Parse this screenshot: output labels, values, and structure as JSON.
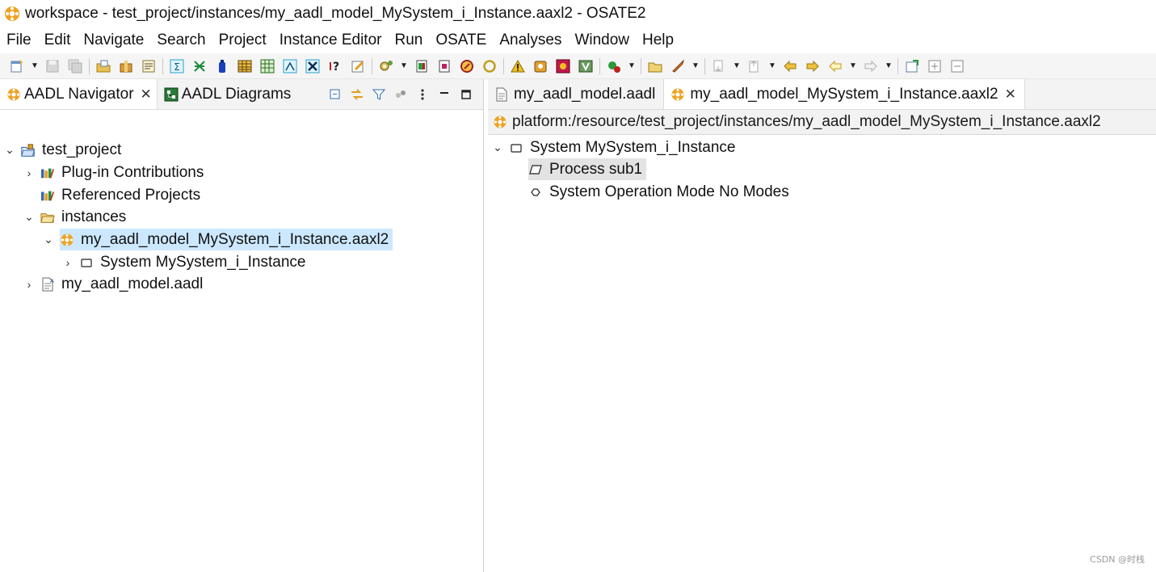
{
  "window": {
    "title": "workspace - test_project/instances/my_aadl_model_MySystem_i_Instance.aaxl2 - OSATE2",
    "app_icon": "osate-logo-icon"
  },
  "menu": [
    "File",
    "Edit",
    "Navigate",
    "Search",
    "Project",
    "Instance Editor",
    "Run",
    "OSATE",
    "Analyses",
    "Window",
    "Help"
  ],
  "toolbar": {
    "icons": [
      "new-icon",
      "save-icon",
      "save-all-icon",
      "open-aadl-icon",
      "package-icon",
      "properties-icon",
      "sigma-icon",
      "graph-icon",
      "bottle-icon",
      "table-icon",
      "grid-icon",
      "image-icon",
      "hourglass-icon",
      "help-question-icon",
      "edit-icon",
      "cog-icon",
      "run-icon",
      "doc-icon",
      "flag-icon",
      "ring-icon",
      "warning-icon",
      "archive-icon",
      "puzzle-icon",
      "shield-icon",
      "bug-icon",
      "folder-icon",
      "rocket-icon",
      "next-annotation-icon",
      "prev-annotation-icon",
      "back-edit-icon",
      "forward-edit-icon",
      "back-icon",
      "forward-icon",
      "pin-icon",
      "maximize-icon",
      "restore-icon"
    ]
  },
  "navigator": {
    "tabs": [
      {
        "label": "AADL Navigator",
        "icon": "aadl-navigator-icon",
        "active": true
      },
      {
        "label": "AADL Diagrams",
        "icon": "aadl-diagrams-icon",
        "active": false
      }
    ],
    "actions": [
      "collapse-all-icon",
      "link-editor-icon",
      "filter-icon",
      "dots-icon",
      "view-menu-icon",
      "minimize-icon",
      "maximize-icon"
    ],
    "tree": [
      {
        "label": "test_project",
        "icon": "project-folder-icon",
        "twisty": "expanded",
        "depth": 0
      },
      {
        "label": "Plug-in Contributions",
        "icon": "library-icon",
        "twisty": "collapsed",
        "depth": 1
      },
      {
        "label": "Referenced Projects",
        "icon": "library-icon",
        "twisty": "none",
        "depth": 1
      },
      {
        "label": "instances",
        "icon": "folder-icon",
        "twisty": "expanded",
        "depth": 1
      },
      {
        "label": "my_aadl_model_MySystem_i_Instance.aaxl2",
        "icon": "instance-file-icon",
        "twisty": "expanded",
        "depth": 2,
        "selected": true
      },
      {
        "label": "System MySystem_i_Instance",
        "icon": "system-icon",
        "twisty": "collapsed",
        "depth": 3
      },
      {
        "label": "my_aadl_model.aadl",
        "icon": "aadl-file-icon",
        "twisty": "collapsed",
        "depth": 1
      }
    ]
  },
  "editor": {
    "tabs": [
      {
        "label": "my_aadl_model.aadl",
        "icon": "aadl-file-icon",
        "active": false
      },
      {
        "label": "my_aadl_model_MySystem_i_Instance.aaxl2",
        "icon": "instance-file-icon",
        "active": true
      }
    ],
    "resource_uri": "platform:/resource/test_project/instances/my_aadl_model_MySystem_i_Instance.aaxl2",
    "tree": [
      {
        "label": "System MySystem_i_Instance",
        "icon": "system-icon",
        "twisty": "expanded",
        "depth": 0
      },
      {
        "label": "Process sub1",
        "icon": "process-icon",
        "twisty": "none",
        "depth": 1,
        "highlight": true
      },
      {
        "label": "System Operation Mode No Modes",
        "icon": "mode-icon",
        "twisty": "none",
        "depth": 1
      }
    ]
  },
  "watermark": "CSDN @时栈",
  "colors": {
    "selection": "#cce8ff",
    "highlight": "#e3e3e3",
    "osate_orange": "#f0a020",
    "toolbar_bg": "#f5f5f5"
  }
}
